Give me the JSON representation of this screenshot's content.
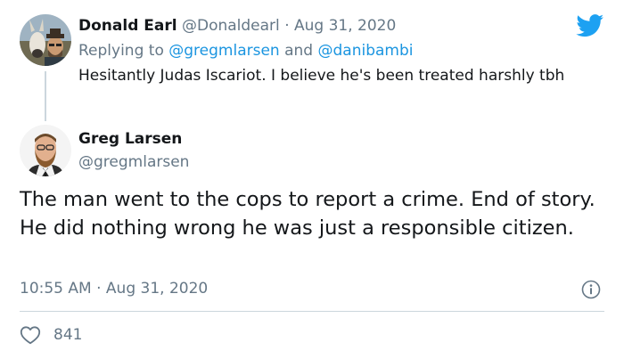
{
  "reply_tweet": {
    "display_name": "Donald Earl",
    "handle": "@Donaldearl",
    "separator": "·",
    "date": "Aug 31, 2020",
    "replying_prefix": "Replying to",
    "replying_user_1": "@gregmlarsen",
    "replying_and": "and",
    "replying_user_2": "@danibambi",
    "text": "Hesitantly Judas Iscariot. I believe he's been treated harshly tbh"
  },
  "main_tweet": {
    "display_name": "Greg Larsen",
    "handle": "@gregmlarsen",
    "text": "The man went to the cops to report a crime. End of story. He did nothing wrong he was just a responsible citizen.",
    "time": "10:55 AM",
    "separator": "·",
    "date": "Aug 31, 2020",
    "like_count": "841"
  },
  "icons": {
    "brand": "twitter-bird-icon",
    "info": "info-icon",
    "like": "heart-icon"
  },
  "colors": {
    "brand_blue": "#1da1f2",
    "link_blue": "#1b95e0",
    "muted_text": "#657786",
    "divider": "#ccd6dd"
  }
}
